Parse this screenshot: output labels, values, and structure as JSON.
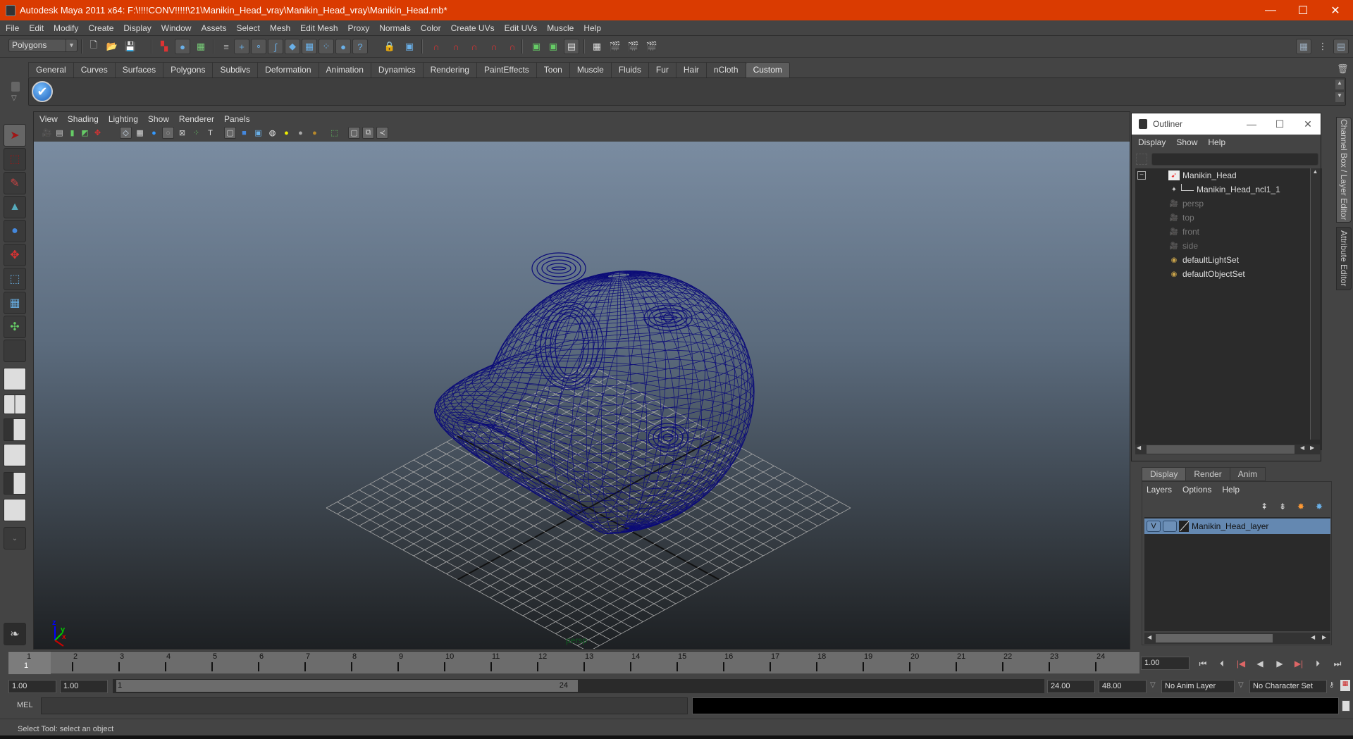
{
  "window": {
    "title": "Autodesk Maya 2011 x64: F:\\!!!!CONV!!!!!\\21\\Manikin_Head_vray\\Manikin_Head_vray\\Manikin_Head.mb*",
    "minimize_icon": "—",
    "maximize_icon": "☐",
    "close_icon": "✕"
  },
  "menubar": [
    "File",
    "Edit",
    "Modify",
    "Create",
    "Display",
    "Window",
    "Assets",
    "Select",
    "Mesh",
    "Edit Mesh",
    "Proxy",
    "Normals",
    "Color",
    "Create UVs",
    "Edit UVs",
    "Muscle",
    "Help"
  ],
  "statusline": {
    "mode": "Polygons",
    "icons": [
      "new-scene",
      "open-scene",
      "save-scene",
      "select-by-hierarchy",
      "select-by-object-type",
      "select-by-component-type",
      "snap-to-grid",
      "snap-to-curve",
      "snap-to-point",
      "snap-to-view-plane",
      "make-live",
      "history",
      "render-current-frame",
      "ipr-render",
      "render-settings",
      "show-hide-channel-box",
      "show-hide-tool-settings",
      "show-hide-attribute-editor"
    ]
  },
  "shelf": {
    "tabs": [
      "General",
      "Curves",
      "Surfaces",
      "Polygons",
      "Subdivs",
      "Deformation",
      "Animation",
      "Dynamics",
      "Rendering",
      "PaintEffects",
      "Toon",
      "Muscle",
      "Fluids",
      "Fur",
      "Hair",
      "nCloth",
      "Custom"
    ],
    "active_tab": "Custom"
  },
  "viewport": {
    "menu": [
      "View",
      "Shading",
      "Lighting",
      "Show",
      "Renderer",
      "Panels"
    ],
    "camera_label": "persp",
    "axis": {
      "x": "x",
      "y": "y",
      "z": "z"
    },
    "wire_color": "#0c0c78",
    "grid_color": "#a8a8a8"
  },
  "outliner": {
    "title": "Outliner",
    "menu": [
      "Display",
      "Show",
      "Help"
    ],
    "filter_value": "",
    "items": [
      {
        "label": "Manikin_Head",
        "icon": "transform-icon",
        "dim": false
      },
      {
        "label": "Manikin_Head_ncl1_1",
        "icon": "mesh-icon",
        "dim": false
      },
      {
        "label": "persp",
        "icon": "camera-icon",
        "dim": true
      },
      {
        "label": "top",
        "icon": "camera-icon",
        "dim": true
      },
      {
        "label": "front",
        "icon": "camera-icon",
        "dim": true
      },
      {
        "label": "side",
        "icon": "camera-icon",
        "dim": true
      },
      {
        "label": "defaultLightSet",
        "icon": "set-icon",
        "dim": false
      },
      {
        "label": "defaultObjectSet",
        "icon": "set-icon",
        "dim": false
      }
    ]
  },
  "sidetabs": [
    "Channel Box / Layer Editor",
    "Attribute Editor"
  ],
  "layer_editor": {
    "tabs": [
      "Display",
      "Render",
      "Anim"
    ],
    "active_tab": "Display",
    "menu": [
      "Layers",
      "Options",
      "Help"
    ],
    "layers": [
      {
        "visible": "V",
        "name": "Manikin_Head_layer"
      }
    ]
  },
  "timeline": {
    "ticks": [
      "1",
      "2",
      "3",
      "4",
      "5",
      "6",
      "7",
      "8",
      "9",
      "10",
      "11",
      "12",
      "13",
      "14",
      "15",
      "16",
      "17",
      "18",
      "19",
      "20",
      "21",
      "22",
      "23",
      "24"
    ],
    "current_frame_marker": "1",
    "current_frame": "1.00",
    "playback_buttons": [
      "go-to-start",
      "step-back-frame",
      "step-back-key",
      "play-backwards",
      "play-forwards",
      "step-forward-key",
      "step-forward-frame",
      "go-to-end"
    ]
  },
  "range": {
    "start_time": "1.00",
    "playback_start": "1.00",
    "slider_start": "1",
    "slider_end": "24",
    "playback_end": "24.00",
    "end_time": "48.00",
    "anim_layer": "No Anim Layer",
    "character_set": "No Character Set"
  },
  "command_line": {
    "label": "MEL",
    "value": ""
  },
  "help_line": "Select Tool: select an object"
}
